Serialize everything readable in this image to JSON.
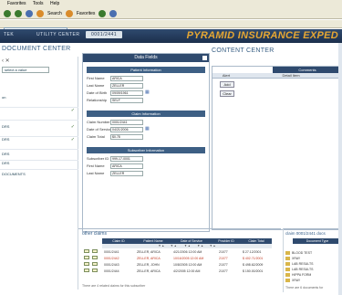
{
  "menu": [
    "Favorites",
    "Tools",
    "Help"
  ],
  "toolbar": {
    "search": "Search",
    "favorites": "Favorites"
  },
  "address": {
    "value": "claim-0001/pyramid.aspx"
  },
  "header": {
    "tabs": [
      "TEK",
      "UTILITY CENTER",
      "0001/2441"
    ],
    "brand": "PYRAMID INSURANCE EXPED"
  },
  "left": {
    "title": "DOCUMENT CENTER",
    "select_value": "select a value",
    "rows": [
      "on",
      "DRS",
      "DRS",
      "DRS",
      "DRS",
      "DOCUMENTS"
    ]
  },
  "form": {
    "title": "Data Fields",
    "patient_header": "Patient Information",
    "claim_header": "Claim Information",
    "subscriber_header": "Subscriber Information",
    "fields": {
      "first_name": {
        "label": "First Name",
        "value": "ARICA"
      },
      "last_name": {
        "label": "Last Name",
        "value": "ZELLER"
      },
      "dob": {
        "label": "Date of Birth",
        "value": "09/09/1961"
      },
      "relationship": {
        "label": "Relationship",
        "value": "SELF"
      },
      "claim_number": {
        "label": "Claim Number",
        "value": "0001/2441"
      },
      "date_of_service": {
        "label": "Date of Service",
        "value": "04/21/2006"
      },
      "claim_total": {
        "label": "Claim Total",
        "value": "$0.78"
      },
      "subscriber_id": {
        "label": "Subscriber ID",
        "value": "999-17-0001"
      },
      "sub_first_name": {
        "label": "First Name",
        "value": "ARICA"
      },
      "sub_last_name": {
        "label": "Last Name",
        "value": "ZELLER"
      }
    }
  },
  "content": {
    "title": "CONTENT CENTER",
    "comments_header": "Comments",
    "col_alert": "Alert",
    "col_detail": "Detail Item",
    "add_button": "Add",
    "clear_button": "Clear"
  },
  "claims": {
    "title": "other claims",
    "columns": [
      "Claim ID",
      "Patient Name",
      "Date of Service",
      "Provider ID",
      "Claim Total"
    ],
    "rows": [
      {
        "id": "0001/2441",
        "name": "ZELLER, ARICA",
        "date": "4/21/2006 12:00 AM",
        "provider": "21077",
        "total": "$ 27.12/2001"
      },
      {
        "id": "0001/2442",
        "name": "ZELLER, ARICA",
        "date": "10/16/2005 12:00 AM",
        "provider": "21077",
        "total": "$ 402.71/2001"
      },
      {
        "id": "0001/2443",
        "name": "ZELLER, JOHN",
        "date": "10/8/2005 12:00 AM",
        "provider": "21077",
        "total": "$ 498.62/2009"
      },
      {
        "id": "0001/2444",
        "name": "ZELLER, ARICA",
        "date": "4/2/2005 12:00 AM",
        "provider": "21077",
        "total": "$ 150.00/2001"
      }
    ],
    "footer": "There are 4 related claims for this subscriber"
  },
  "documents": {
    "title": "claim 0001/2441 docs",
    "column": "Document Type",
    "rows": [
      "BLOOD TEST",
      "XRAY",
      "LAB RESULTS",
      "LAB RESULTS",
      "HIPPA FORM",
      "XRAY"
    ],
    "footer": "There are 6 documents for"
  }
}
